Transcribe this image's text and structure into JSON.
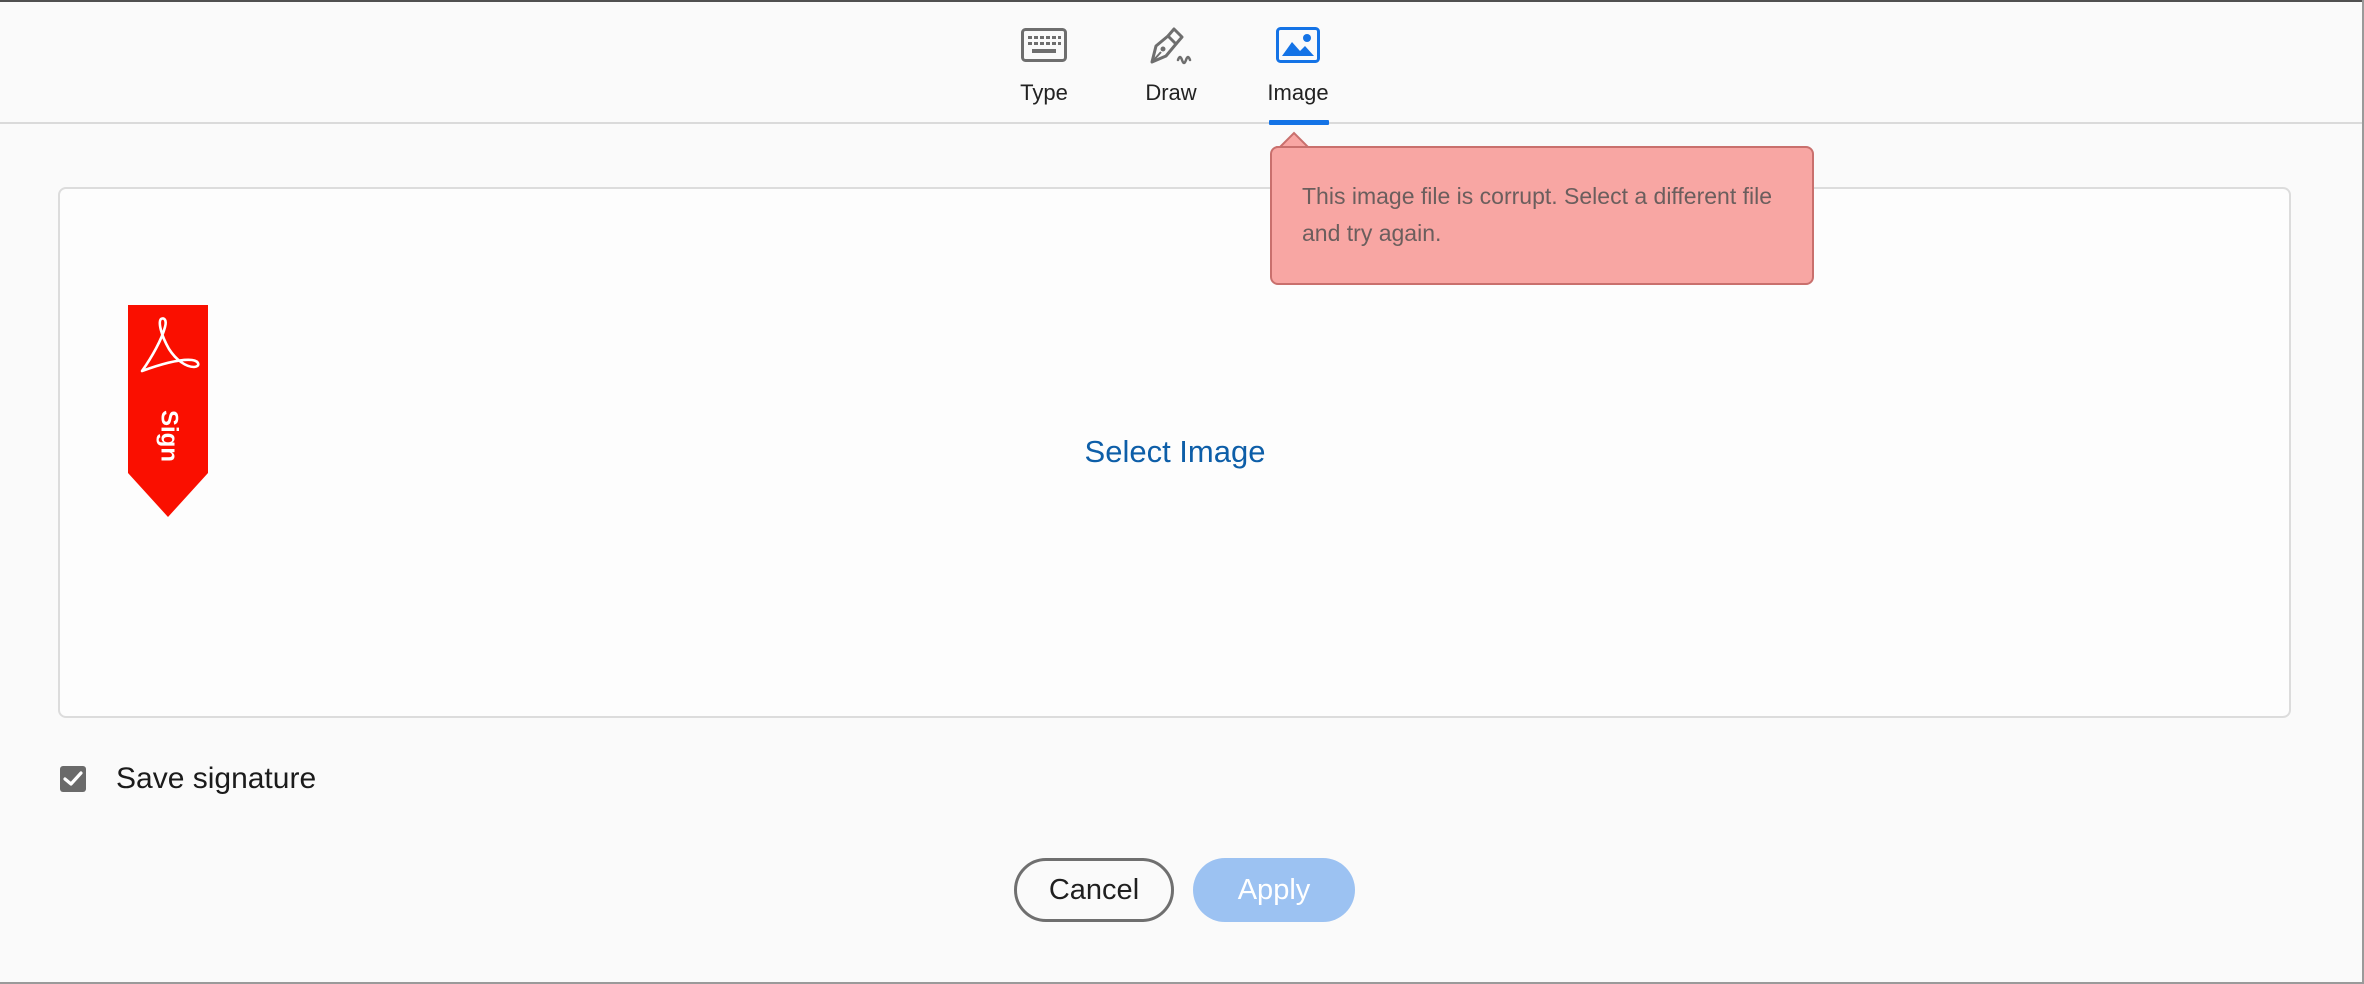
{
  "tabs": [
    {
      "label": "Type",
      "icon": "keyboard-icon",
      "active": false
    },
    {
      "label": "Draw",
      "icon": "pen-icon",
      "active": false
    },
    {
      "label": "Image",
      "icon": "image-icon",
      "active": true
    }
  ],
  "canvas": {
    "select_label": "Select Image",
    "ribbon_text": "Sign"
  },
  "tooltip": {
    "message": "This image file is corrupt. Select a different file and try again."
  },
  "save_signature": {
    "label": "Save signature",
    "checked": true
  },
  "buttons": {
    "cancel": "Cancel",
    "apply": "Apply"
  },
  "colors": {
    "accent": "#1473e6",
    "link": "#0d5ea8",
    "error_bg": "#f8a6a3",
    "ribbon": "#fa0f00",
    "apply_disabled": "#9cc2f2"
  }
}
